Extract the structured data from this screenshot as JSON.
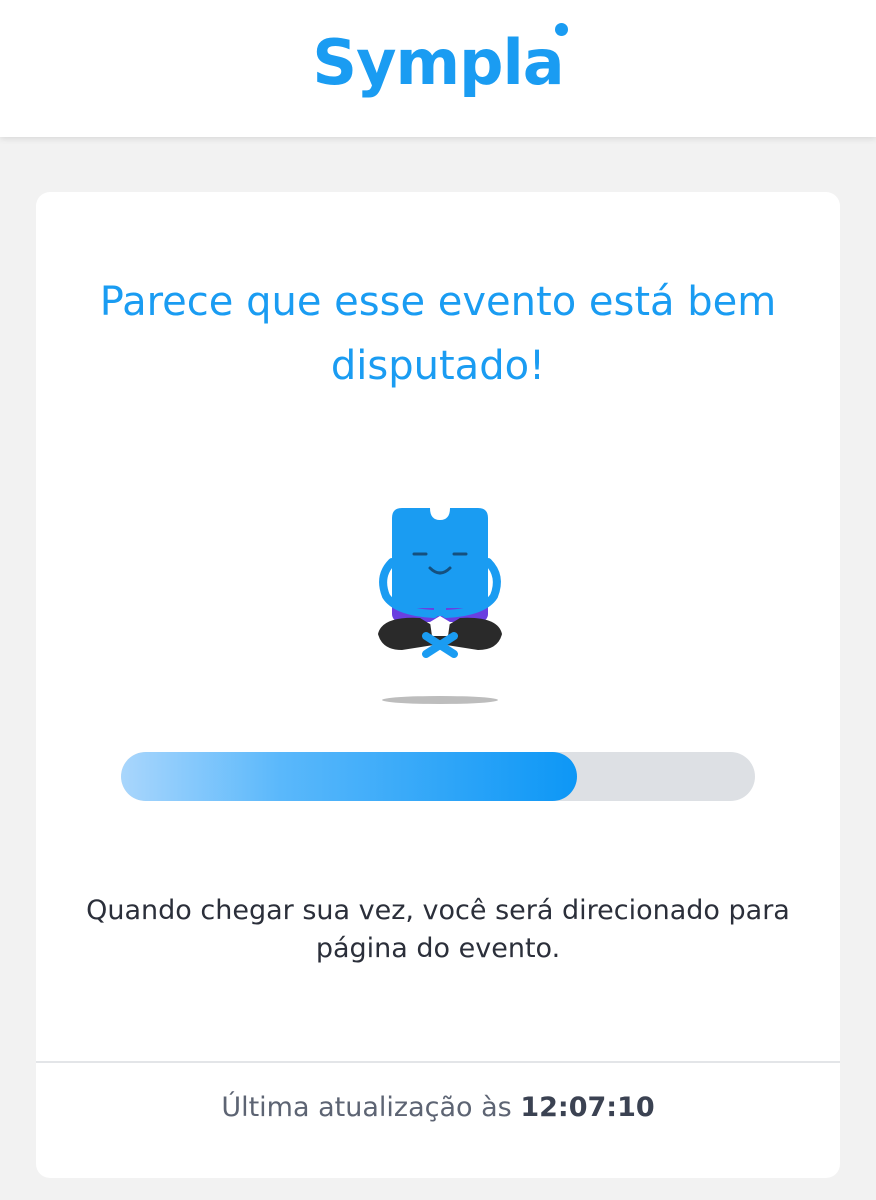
{
  "header": {
    "logo_text": "Sympla",
    "brand_color": "#1a9cf2"
  },
  "queue": {
    "title": "Parece que esse evento está bem disputado!",
    "mascot_icon": "meditating-ticket-mascot-icon",
    "progress_percent": 72,
    "progress_colors": [
      "#a9d6fc",
      "#0d97f6"
    ],
    "message": "Quando chegar sua vez, você será direcionado para página do evento."
  },
  "footer": {
    "last_update_label": "Última atualização às",
    "last_update_time": "12:07:10"
  }
}
